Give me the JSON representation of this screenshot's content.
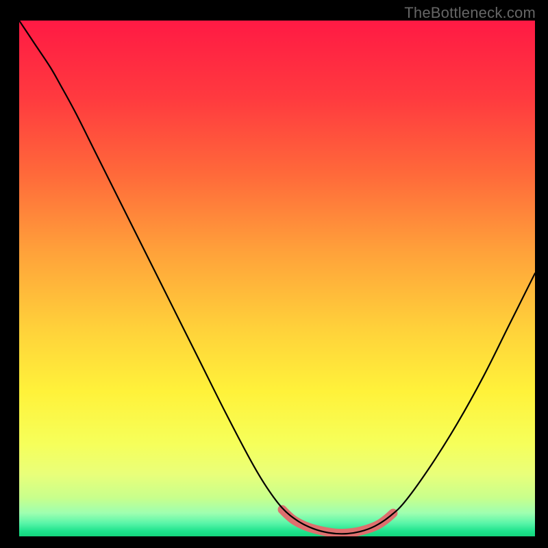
{
  "watermark": "TheBottleneck.com",
  "chart_data": {
    "type": "line",
    "title": "",
    "xlabel": "",
    "ylabel": "",
    "xlim": [
      0,
      100
    ],
    "ylim": [
      0,
      100
    ],
    "background_gradient": {
      "stops": [
        {
          "pos": 0.0,
          "color": "#ff1a44"
        },
        {
          "pos": 0.15,
          "color": "#ff3a3f"
        },
        {
          "pos": 0.3,
          "color": "#ff6a3a"
        },
        {
          "pos": 0.45,
          "color": "#ffa23a"
        },
        {
          "pos": 0.6,
          "color": "#ffd23a"
        },
        {
          "pos": 0.72,
          "color": "#fff23a"
        },
        {
          "pos": 0.82,
          "color": "#f6ff5a"
        },
        {
          "pos": 0.88,
          "color": "#e9ff7a"
        },
        {
          "pos": 0.925,
          "color": "#c8ff8c"
        },
        {
          "pos": 0.955,
          "color": "#9effb0"
        },
        {
          "pos": 0.975,
          "color": "#58f5a8"
        },
        {
          "pos": 0.99,
          "color": "#1ee38c"
        },
        {
          "pos": 1.0,
          "color": "#14d67c"
        }
      ]
    },
    "series": [
      {
        "name": "bottleneck-curve",
        "color": "#000000",
        "width": 2.2,
        "points": [
          {
            "x": 0.0,
            "y": 100.0
          },
          {
            "x": 3.0,
            "y": 95.5
          },
          {
            "x": 6.0,
            "y": 91.0
          },
          {
            "x": 8.0,
            "y": 87.5
          },
          {
            "x": 11.0,
            "y": 82.0
          },
          {
            "x": 15.0,
            "y": 74.0
          },
          {
            "x": 20.0,
            "y": 64.0
          },
          {
            "x": 25.0,
            "y": 54.0
          },
          {
            "x": 30.0,
            "y": 44.0
          },
          {
            "x": 35.0,
            "y": 34.0
          },
          {
            "x": 40.0,
            "y": 24.0
          },
          {
            "x": 45.0,
            "y": 14.5
          },
          {
            "x": 48.0,
            "y": 9.5
          },
          {
            "x": 51.0,
            "y": 5.5
          },
          {
            "x": 54.0,
            "y": 3.0
          },
          {
            "x": 57.0,
            "y": 1.5
          },
          {
            "x": 60.0,
            "y": 0.7
          },
          {
            "x": 63.0,
            "y": 0.5
          },
          {
            "x": 66.0,
            "y": 0.9
          },
          {
            "x": 69.0,
            "y": 2.0
          },
          {
            "x": 72.0,
            "y": 4.0
          },
          {
            "x": 75.0,
            "y": 7.0
          },
          {
            "x": 80.0,
            "y": 14.0
          },
          {
            "x": 85.0,
            "y": 22.0
          },
          {
            "x": 90.0,
            "y": 31.0
          },
          {
            "x": 95.0,
            "y": 41.0
          },
          {
            "x": 100.0,
            "y": 51.0
          }
        ]
      }
    ],
    "highlight": {
      "name": "optimal-zone",
      "color": "#de6f6e",
      "width": 13,
      "linecap": "round",
      "points": [
        {
          "x": 51.0,
          "y": 5.2
        },
        {
          "x": 52.0,
          "y": 4.2
        },
        {
          "x": 53.5,
          "y": 3.0
        },
        {
          "x": 56.0,
          "y": 1.8
        },
        {
          "x": 59.0,
          "y": 1.0
        },
        {
          "x": 62.0,
          "y": 0.6
        },
        {
          "x": 65.0,
          "y": 0.8
        },
        {
          "x": 67.5,
          "y": 1.4
        },
        {
          "x": 69.5,
          "y": 2.2
        },
        {
          "x": 71.0,
          "y": 3.2
        },
        {
          "x": 72.5,
          "y": 4.5
        }
      ]
    }
  }
}
